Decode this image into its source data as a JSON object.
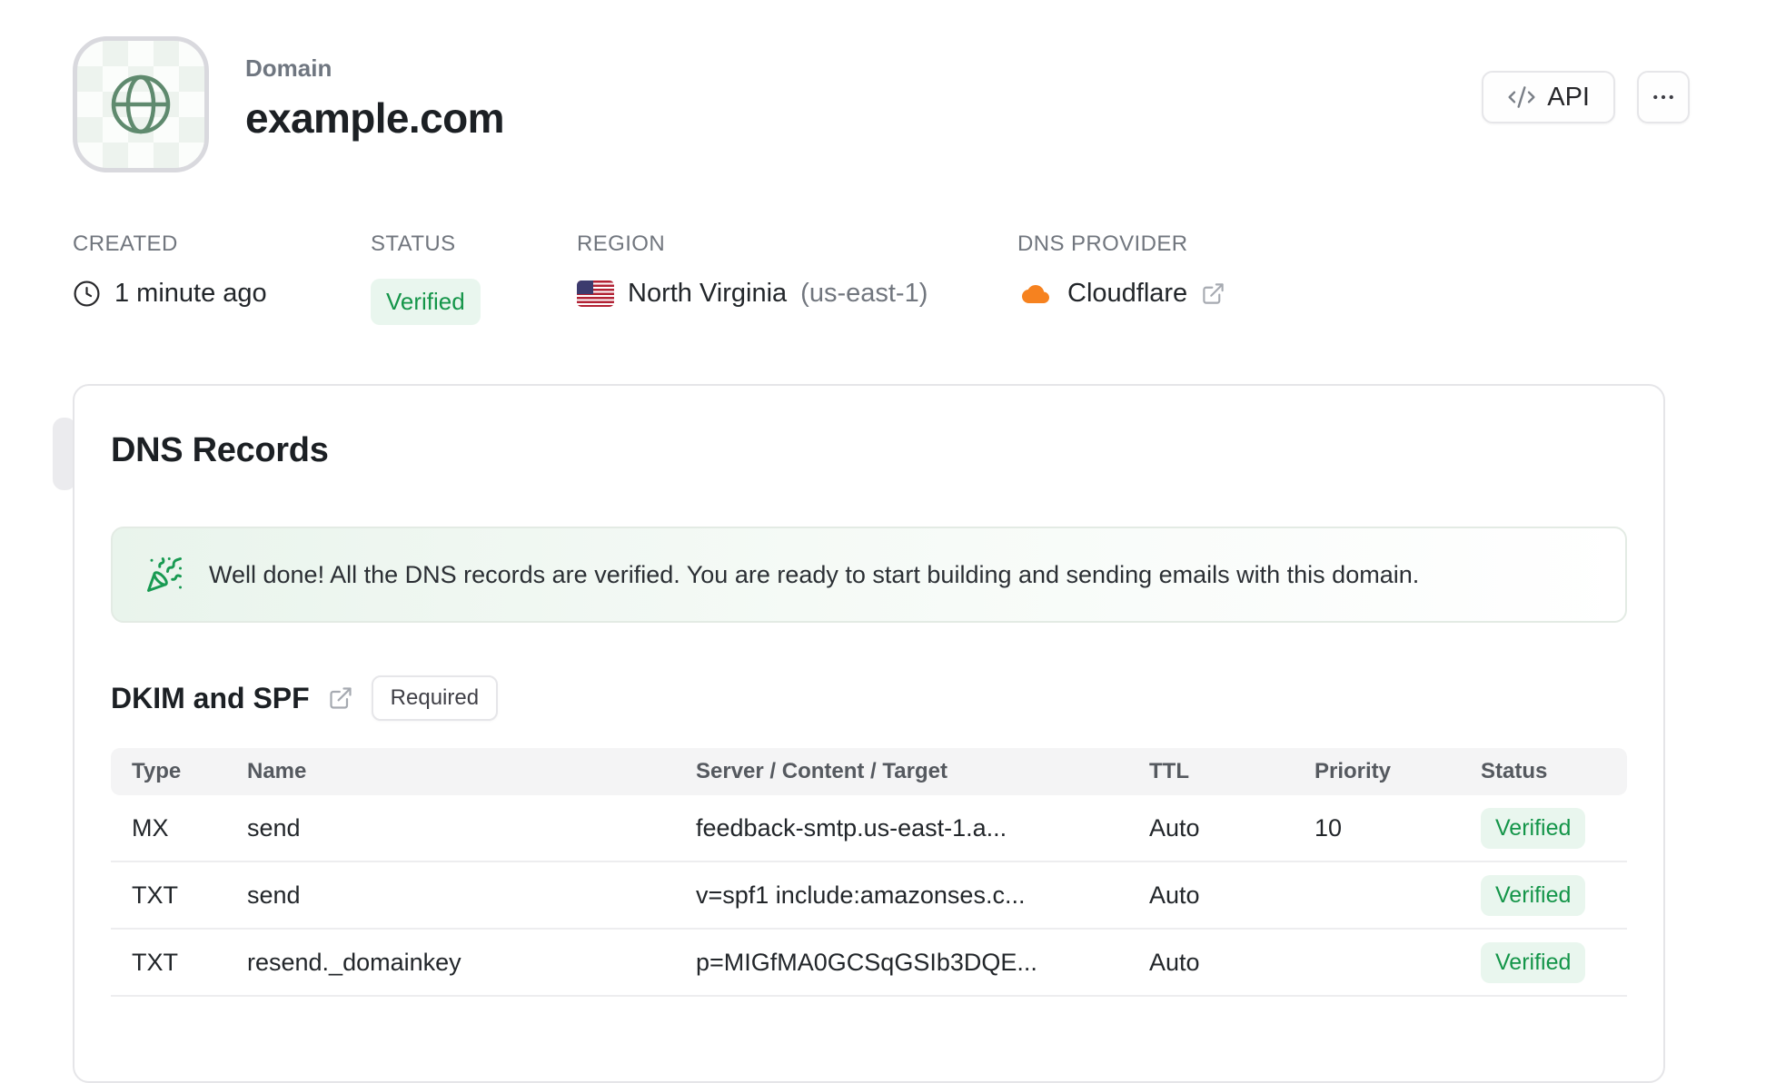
{
  "header": {
    "eyebrow": "Domain",
    "domain": "example.com",
    "api_button_label": "API"
  },
  "meta": {
    "created": {
      "label": "CREATED",
      "value": "1 minute ago"
    },
    "status": {
      "label": "STATUS",
      "value": "Verified"
    },
    "region": {
      "label": "REGION",
      "value": "North Virginia",
      "code": "(us-east-1)"
    },
    "dns_provider": {
      "label": "DNS PROVIDER",
      "value": "Cloudflare"
    }
  },
  "dns_records": {
    "heading": "DNS Records",
    "banner_message": "Well done! All the DNS records are verified. You are ready to start building and sending emails with this domain.",
    "section": {
      "heading": "DKIM and SPF",
      "badge": "Required"
    },
    "table": {
      "headers": [
        "Type",
        "Name",
        "Server / Content / Target",
        "TTL",
        "Priority",
        "Status"
      ],
      "rows": [
        {
          "type": "MX",
          "name": "send",
          "content": "feedback-smtp.us-east-1.a...",
          "ttl": "Auto",
          "priority": "10",
          "status": "Verified"
        },
        {
          "type": "TXT",
          "name": "send",
          "content": "v=spf1 include:amazonses.c...",
          "ttl": "Auto",
          "priority": "",
          "status": "Verified"
        },
        {
          "type": "TXT",
          "name": "resend._domainkey",
          "content": "p=MIGfMA0GCSqGSIb3DQE...",
          "ttl": "Auto",
          "priority": "",
          "status": "Verified"
        }
      ]
    }
  },
  "colors": {
    "accent_green": "#149549",
    "badge_green_bg": "#e9f6ee",
    "globe_green": "#5f8a6e",
    "cloudflare_orange": "#f6821f",
    "border_gray": "#e5e5e8"
  }
}
